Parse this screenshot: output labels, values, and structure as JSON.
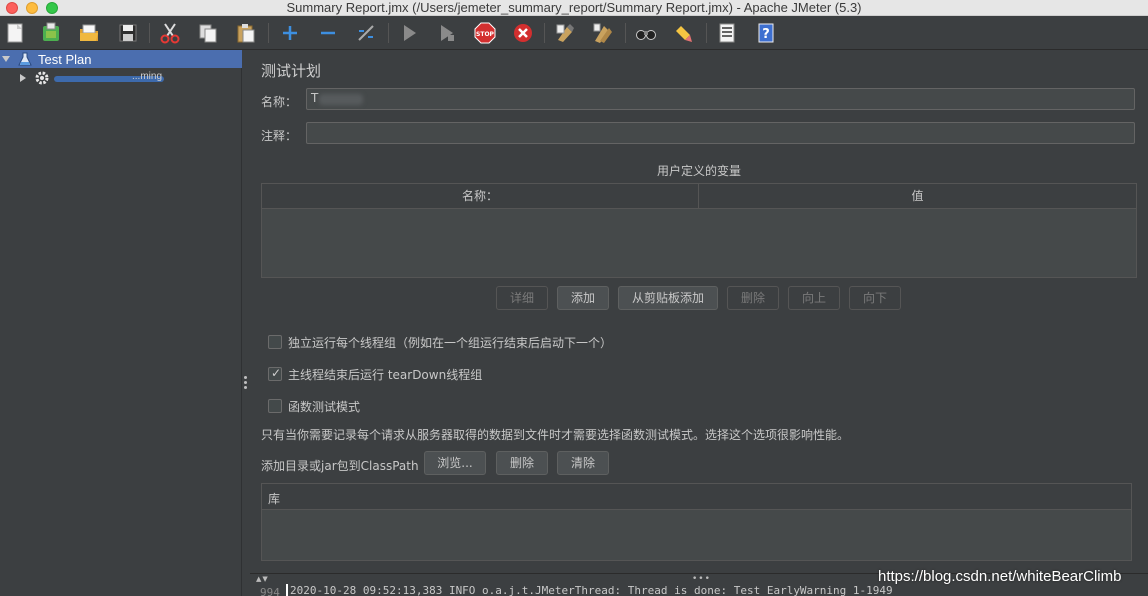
{
  "window": {
    "title": "Summary Report.jmx (/Users/jemeter_summary_report/Summary Report.jmx) - Apache JMeter (5.3)"
  },
  "toolbar": {
    "icons": [
      "new-icon",
      "templates-icon",
      "open-icon",
      "save-icon",
      "cut-icon",
      "copy-icon",
      "paste-icon",
      "expand-icon",
      "collapse-icon",
      "toggle-icon",
      "start-icon",
      "start-no-pauses-icon",
      "stop-icon",
      "shutdown-icon",
      "clear-icon",
      "clear-all-icon",
      "search-icon",
      "reset-search-icon",
      "function-helper-icon",
      "help-icon"
    ]
  },
  "tree": {
    "root_label": "Test Plan",
    "child_label": "...ming"
  },
  "main": {
    "title": "测试计划",
    "name_label": "名称：",
    "name_value": "T",
    "comment_label": "注释：",
    "comment_value": "",
    "variables_caption": "用户定义的变量",
    "table_headers": [
      "名称：",
      "值"
    ],
    "buttons": {
      "detail": "详细",
      "add": "添加",
      "add_from_clipboard": "从剪贴板添加",
      "delete": "删除",
      "up": "向上",
      "down": "向下"
    },
    "options": [
      {
        "label": "独立运行每个线程组（例如在一个组运行结束后启动下一个）",
        "checked": false
      },
      {
        "label": "主线程结束后运行 tearDown线程组",
        "checked": true
      },
      {
        "label": "函数测试模式",
        "checked": false
      }
    ],
    "note": "只有当你需要记录每个请求从服务器取得的数据到文件时才需要选择函数测试模式。选择这个选项很影响性能。",
    "classpath_label": "添加目录或jar包到ClassPath",
    "classpath_buttons": {
      "browse": "浏览...",
      "delete": "删除",
      "clear": "清除"
    },
    "library_header": "库"
  },
  "log": {
    "line_number": "994",
    "text": "2020-10-28 09:52:13,383 INFO o.a.j.t.JMeterThread: Thread is done: Test EarlyWarning 1-1949"
  },
  "watermark": "https://blog.csdn.net/whiteBearClimb",
  "colors": {
    "background": "#3c3f41",
    "selection": "#4b6eaf",
    "field": "#45494a"
  }
}
